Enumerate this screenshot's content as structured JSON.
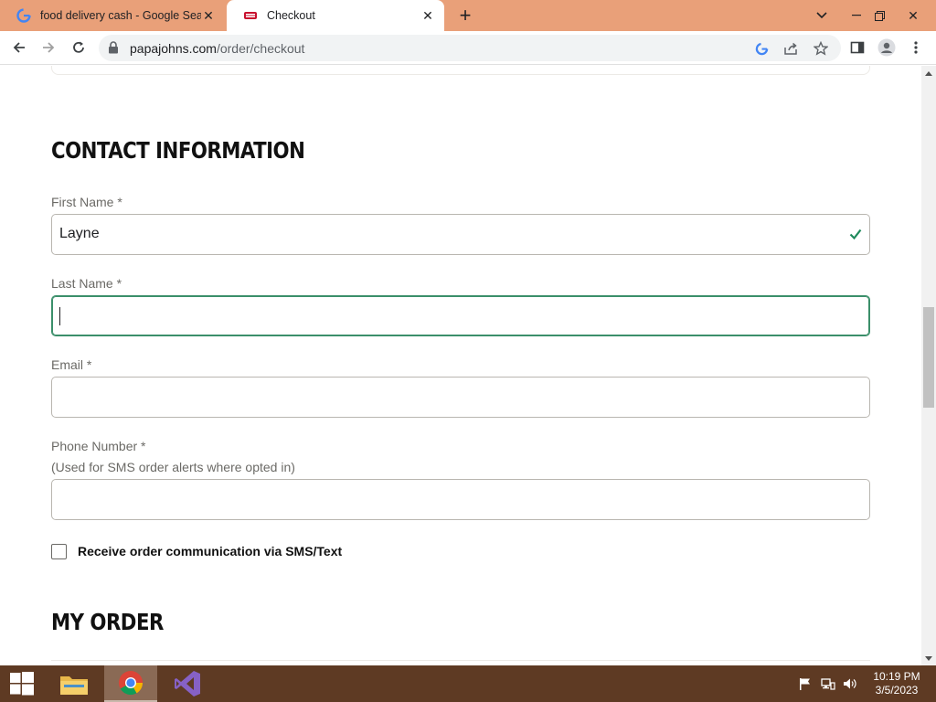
{
  "browser": {
    "tabs": [
      {
        "title": "food delivery cash - Google Sear",
        "favicon": "google-g-icon",
        "active": false
      },
      {
        "title": "Checkout",
        "favicon": "papa-johns-icon",
        "active": true
      }
    ],
    "address": {
      "domain": "papajohns.com",
      "path": "/order/checkout"
    }
  },
  "contact": {
    "title": "CONTACT INFORMATION",
    "first_name": {
      "label": "First Name *",
      "value": "Layne"
    },
    "last_name": {
      "label": "Last Name *",
      "value": ""
    },
    "email": {
      "label": "Email *",
      "value": ""
    },
    "phone": {
      "label": "Phone Number *",
      "sublabel": "(Used for SMS order alerts where opted in)",
      "value": ""
    },
    "sms_optin": {
      "label": "Receive order communication via SMS/Text",
      "checked": false
    }
  },
  "order": {
    "title": "MY ORDER"
  },
  "taskbar": {
    "time": "10:19 PM",
    "date": "3/5/2023"
  },
  "colors": {
    "tab_strip": "#e9a079",
    "focus_green": "#3b8f6a",
    "taskbar": "#5e3a23"
  }
}
